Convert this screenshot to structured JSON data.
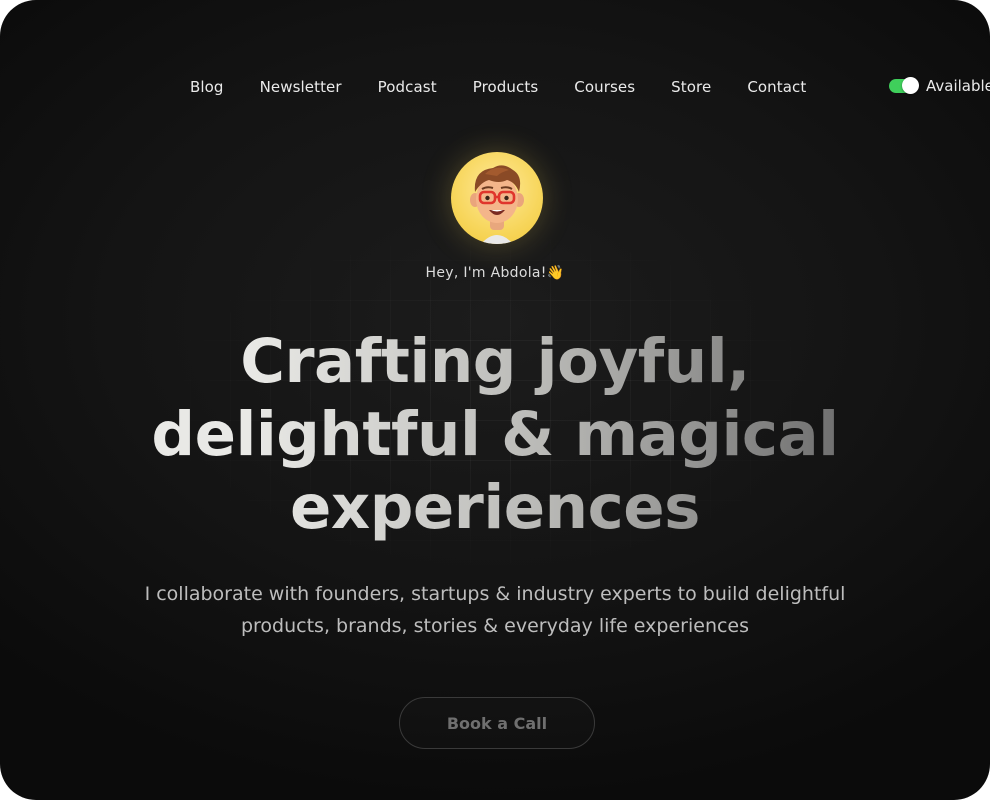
{
  "nav": {
    "items": [
      {
        "label": "Blog"
      },
      {
        "label": "Newsletter"
      },
      {
        "label": "Podcast"
      },
      {
        "label": "Products"
      },
      {
        "label": "Courses"
      },
      {
        "label": "Store"
      },
      {
        "label": "Contact"
      }
    ]
  },
  "availability": {
    "label": "Available",
    "toggle_on": true,
    "toggle_color": "#3fcf5b"
  },
  "hero": {
    "avatar_icon": "memoji-avatar-icon",
    "greeting": "Hey,  I'm Abdola!👋",
    "headline_lines": [
      "Crafting joyful,",
      "delightful & magical",
      "experiences"
    ],
    "subtext_lines": [
      "I collaborate with founders, startups & industry experts to build delightful",
      "products, brands, stories & everyday life experiences"
    ],
    "cta_label": "Book a Call"
  },
  "colors": {
    "background": "#141414",
    "avatar_bg": "#f7d65c",
    "text": "#eaeaea"
  }
}
